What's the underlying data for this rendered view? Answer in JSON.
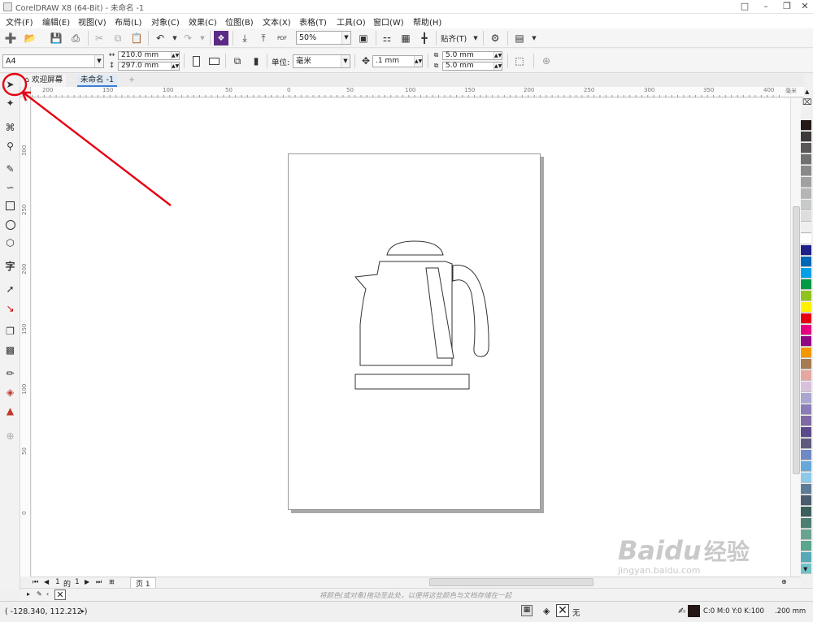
{
  "window": {
    "title": "CorelDRAW X8 (64-Bit) - 未命名 -1"
  },
  "menu": [
    "文件(F)",
    "编辑(E)",
    "视图(V)",
    "布局(L)",
    "对象(C)",
    "效果(C)",
    "位图(B)",
    "文本(X)",
    "表格(T)",
    "工具(O)",
    "窗口(W)",
    "帮助(H)"
  ],
  "toolbar": {
    "zoom": "50%",
    "snap_label": "贴齐(T)",
    "pdf_label": "PDF"
  },
  "property_bar": {
    "page_size": "A4",
    "width": "210.0 mm",
    "height": "297.0 mm",
    "units_label": "单位:",
    "units_value": "毫米",
    "nudge": ".1 mm",
    "dup_x": "5.0 mm",
    "dup_y": "5.0 mm"
  },
  "tabs": {
    "welcome": "欢迎屏幕",
    "document": "未命名 -1"
  },
  "ruler": {
    "h_labels": [
      "200",
      "150",
      "100",
      "50",
      "0",
      "50",
      "100",
      "150",
      "200",
      "250",
      "300",
      "350",
      "400"
    ],
    "h_unit": "毫米",
    "v_labels": [
      "300",
      "250",
      "200",
      "150",
      "100",
      "50",
      "0"
    ]
  },
  "page_nav": {
    "current": "1",
    "of_label": "的",
    "total": "1",
    "page_tab": "页 1"
  },
  "colorbar_hint": "将颜色(或对象)拖动至此处，以便将这些颜色与文档存储在一起",
  "status": {
    "coords": "( -128.340, 112.212 )",
    "fill_none": "无",
    "outline_color": "C:0 M:0 Y:0 K:100",
    "outline_width": ".200 mm"
  },
  "palette": [
    "#231815",
    "#3e3a39",
    "#595757",
    "#727171",
    "#898989",
    "#9fa0a0",
    "#b5b5b6",
    "#c9caca",
    "#dcdddd",
    "#efefef",
    "#ffffff",
    "#1d2088",
    "#0068b7",
    "#00a0e9",
    "#009944",
    "#8fc31f",
    "#fff100",
    "#e60012",
    "#e4007f",
    "#920783",
    "#f39800",
    "#a67c52",
    "#e5a7a0",
    "#d9c0dd",
    "#aaa6d1",
    "#8c7cb8",
    "#7f6aa7",
    "#5b4a8b",
    "#5e5b7f",
    "#6f89c3",
    "#68a8d8",
    "#8ec8e8",
    "#5d7b96",
    "#4b5c6e",
    "#3b5f5a",
    "#4a7f71",
    "#6aa392",
    "#5aa68f",
    "#56a9b7",
    "#72c3c7"
  ],
  "watermark": {
    "brand": "Baidu",
    "brand_cn": "经验",
    "url": "jingyan.baidu.com"
  }
}
